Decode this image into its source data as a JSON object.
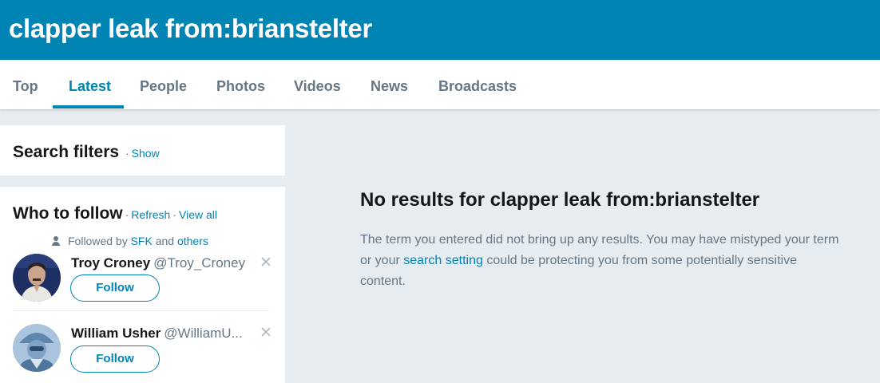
{
  "header": {
    "query_title": "clapper leak from:brianstelter"
  },
  "nav": {
    "tabs": [
      {
        "label": "Top"
      },
      {
        "label": "Latest"
      },
      {
        "label": "People"
      },
      {
        "label": "Photos"
      },
      {
        "label": "Videos"
      },
      {
        "label": "News"
      },
      {
        "label": "Broadcasts"
      }
    ],
    "active": "Latest"
  },
  "search_filters": {
    "title": "Search filters",
    "show_label": "Show"
  },
  "who_to_follow": {
    "title": "Who to follow",
    "refresh_label": "Refresh",
    "view_all_label": "View all",
    "followed_by_prefix": "Followed by",
    "followed_by_user": "SFK",
    "followed_by_and": "and",
    "followed_by_others": "others",
    "follow_label": "Follow",
    "users": [
      {
        "name": "Troy Croney",
        "handle": "@Troy_Croney",
        "avatar": "avatar-photo"
      },
      {
        "name": "William Usher",
        "handle": "@WilliamU...",
        "avatar": "avatar-illustration"
      }
    ]
  },
  "main": {
    "no_results_title": "No results for clapper leak from:brianstelter",
    "body_part1": "The term you entered did not bring up any results. You may have mistyped your term or your",
    "body_link": "search setting",
    "body_part2": "could be protecting you from some potentially sensitive content."
  },
  "colors": {
    "brand": "#0084b4",
    "background": "#e6ecf0",
    "muted": "#657786"
  }
}
